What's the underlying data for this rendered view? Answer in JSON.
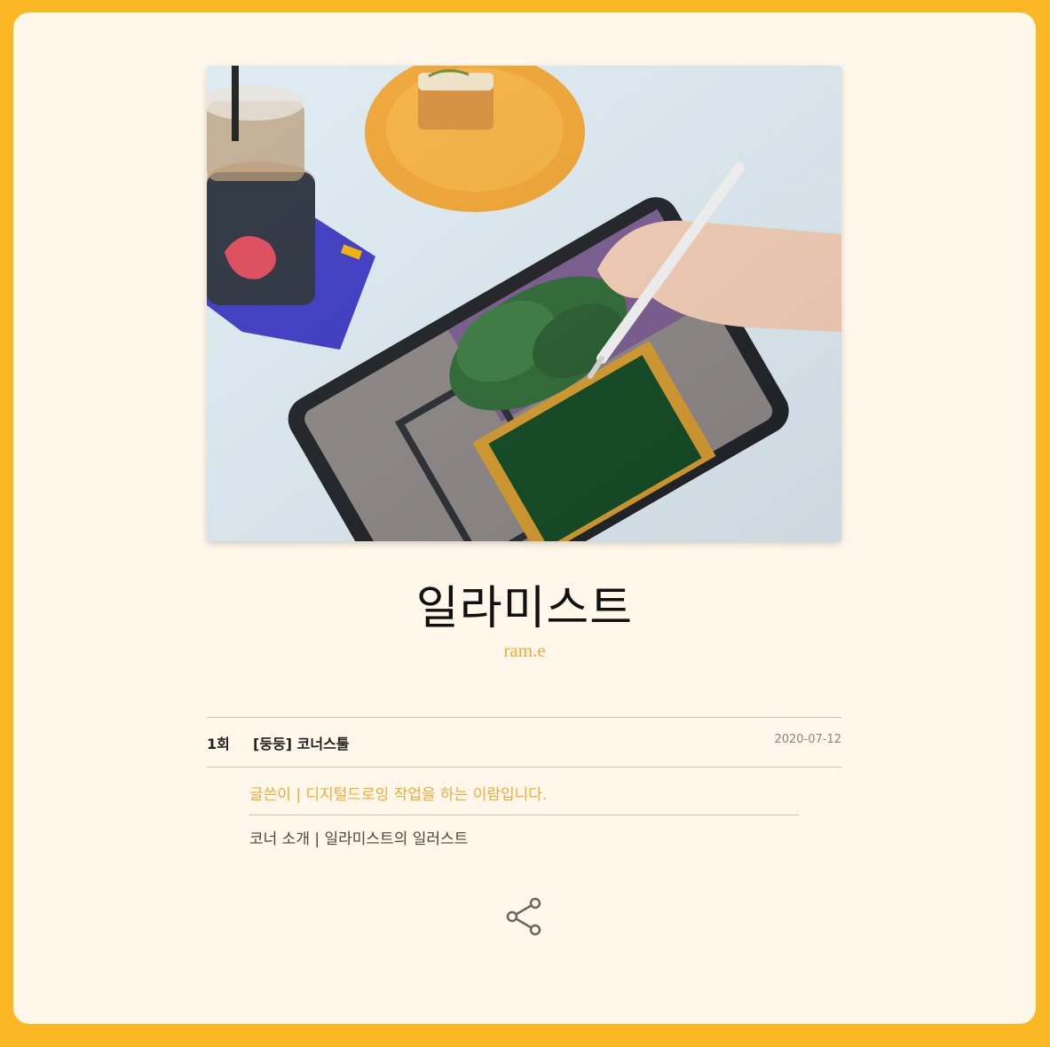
{
  "cover": {
    "alt": "cover illustration"
  },
  "title": "일라미스트",
  "author": "ram.e",
  "episode": {
    "number": "1회",
    "title": "[둥둥] 코너스툴",
    "date": "2020-07-12"
  },
  "intro": {
    "writer": "글쓴이 | 디지털드로잉 작업을 하는 이람입니다.",
    "corner": "코너 소개 | 일라미스트의 일러스트"
  },
  "share": {
    "icon": "share-icon"
  },
  "colors": {
    "background": "#FBB623",
    "card": "#FFF8EA",
    "accent": "#F2A93B"
  }
}
